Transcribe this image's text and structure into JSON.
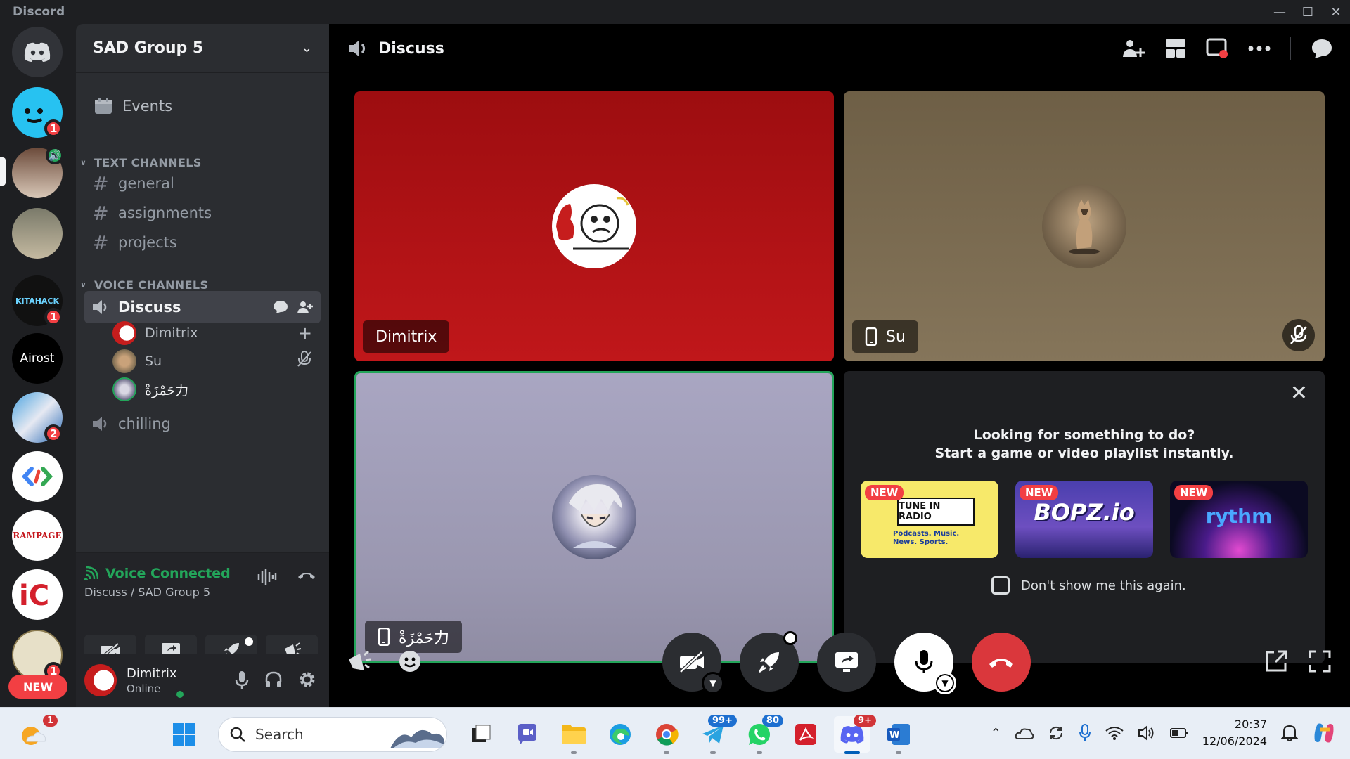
{
  "window": {
    "brand": "Discord"
  },
  "rail": {
    "badges": {
      "blob": "1",
      "kitahack": "1",
      "anime": "2",
      "camp": "1"
    },
    "servers": {
      "airost": "Airost",
      "kitahack": "KITAHACK",
      "rampage": "RAMPAGE"
    },
    "new_label": "NEW"
  },
  "guild": {
    "name": "SAD Group 5",
    "events_label": "Events"
  },
  "categories": {
    "text": "TEXT CHANNELS",
    "voice": "VOICE CHANNELS"
  },
  "text_channels": [
    "general",
    "assignments",
    "projects"
  ],
  "voice_channels": {
    "active": "Discuss",
    "members": [
      "Dimitrix",
      "Su",
      "حَمْزَةْ力"
    ],
    "other": "chilling"
  },
  "voice_panel": {
    "status": "Voice Connected",
    "location": "Discuss / SAD Group 5"
  },
  "user": {
    "name": "Dimitrix",
    "status": "Online"
  },
  "call": {
    "channel_title": "Discuss",
    "tiles": [
      {
        "name": "Dimitrix",
        "bg": "#a80f10"
      },
      {
        "name": "Su",
        "bg": "#7a6a50"
      },
      {
        "name": "حَمْزَةْ力",
        "bg": "#a8a5c0"
      }
    ],
    "activity": {
      "line1": "Looking for something to do?",
      "line2": "Start a game or video playlist instantly.",
      "cards": [
        {
          "badge": "NEW",
          "title": "TUNE IN RADIO",
          "sub": "Podcasts. Music. News. Sports."
        },
        {
          "badge": "NEW",
          "title": "BOPZ.io"
        },
        {
          "badge": "NEW",
          "title": "rythm"
        }
      ],
      "dont_show": "Don't show me this again."
    }
  },
  "taskbar": {
    "search_placeholder": "Search",
    "badges": {
      "telegram": "99+",
      "whatsapp": "80",
      "discord": "9+",
      "weather": "1"
    },
    "time": "20:37",
    "date": "12/06/2024"
  },
  "colors": {
    "accent": "#5865f2",
    "green": "#23a55a",
    "red": "#da373c"
  }
}
